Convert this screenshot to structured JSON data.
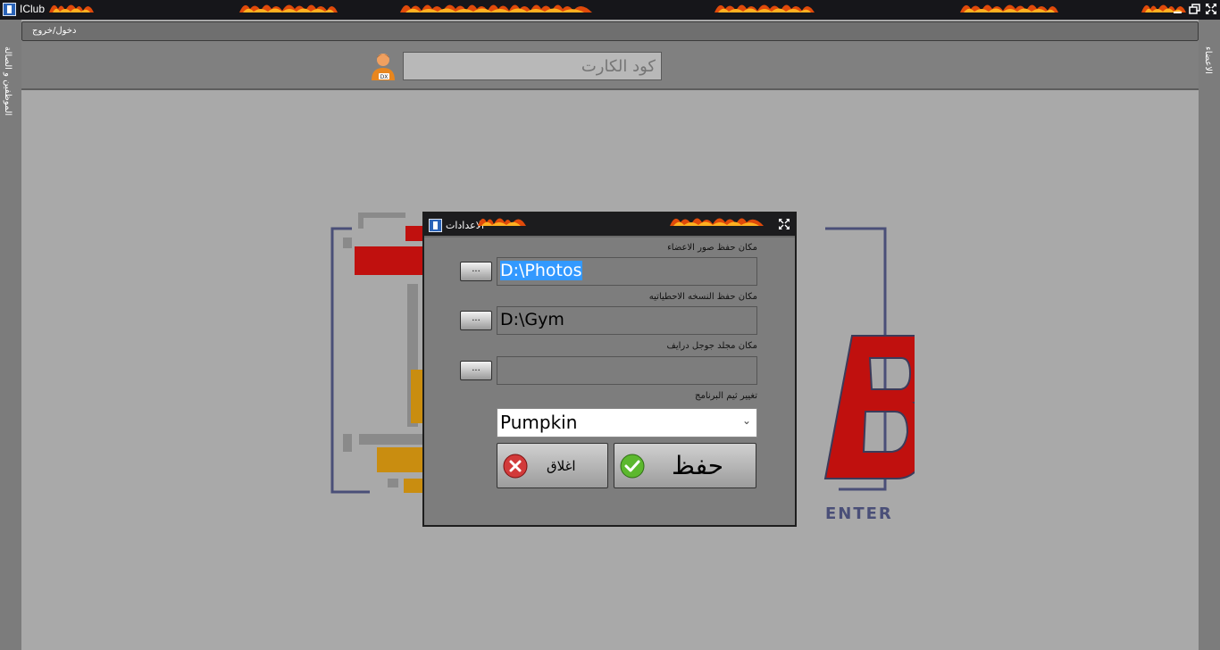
{
  "window": {
    "title": "IClub"
  },
  "menu": {
    "login_logout": "دخول/خروج"
  },
  "side": {
    "left_label": "الموظفين و الصالة",
    "right_label": "الاعضاء"
  },
  "card": {
    "placeholder": "كود الكارت"
  },
  "dialog": {
    "title": "الاعدادات",
    "photos_label": "مكان حفظ صور الاعضاء",
    "photos_path": "D:\\Photos",
    "backup_label": "مكان حفظ النسخه الاحطياتيه",
    "backup_path": "D:\\Gym",
    "drive_label": "مكان مجلد جوجل درايف",
    "drive_path": "",
    "browse_label": "...",
    "theme_label": "تغيير ثيم البرنامج",
    "theme_value": "Pumpkin",
    "save_label": "حفظ",
    "close_label": "اغلاق"
  },
  "logo": {
    "text": "ENTER"
  },
  "colors": {
    "titlebar": "#16161a",
    "panel": "#7d7d7d",
    "selection": "#3399ff",
    "logo_red": "#c0100e",
    "logo_gold": "#c98d10"
  }
}
